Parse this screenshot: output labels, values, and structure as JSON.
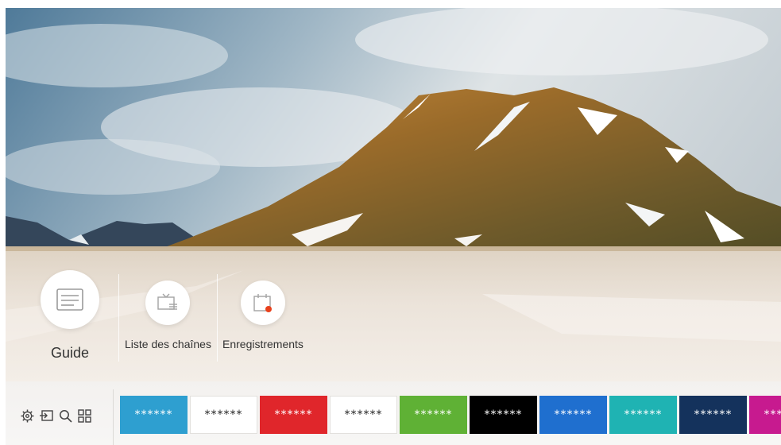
{
  "apps": [
    {
      "label": "Guide",
      "icon": "guide-icon"
    },
    {
      "label": "Liste des chaînes",
      "icon": "channel-list-icon"
    },
    {
      "label": "Enregistrements",
      "icon": "recordings-icon"
    }
  ],
  "toolbar": {
    "icons": [
      "settings-icon",
      "source-icon",
      "search-icon",
      "apps-grid-icon"
    ]
  },
  "tiles": [
    {
      "text": "******",
      "bg": "#2e9fd0",
      "fg": "#ffffff"
    },
    {
      "text": "******",
      "bg": "#ffffff",
      "fg": "#222222"
    },
    {
      "text": "******",
      "bg": "#e0262b",
      "fg": "#ffffff"
    },
    {
      "text": "******",
      "bg": "#ffffff",
      "fg": "#222222"
    },
    {
      "text": "******",
      "bg": "#5fb135",
      "fg": "#ffffff"
    },
    {
      "text": "******",
      "bg": "#000000",
      "fg": "#ffffff"
    },
    {
      "text": "******",
      "bg": "#1f6fcf",
      "fg": "#ffffff"
    },
    {
      "text": "******",
      "bg": "#1fb3b3",
      "fg": "#ffffff"
    },
    {
      "text": "******",
      "bg": "#14325c",
      "fg": "#ffffff"
    },
    {
      "text": "******",
      "bg": "#c71a8f",
      "fg": "#ffffff"
    }
  ],
  "colors": {
    "accent_record": "#e8401c"
  }
}
